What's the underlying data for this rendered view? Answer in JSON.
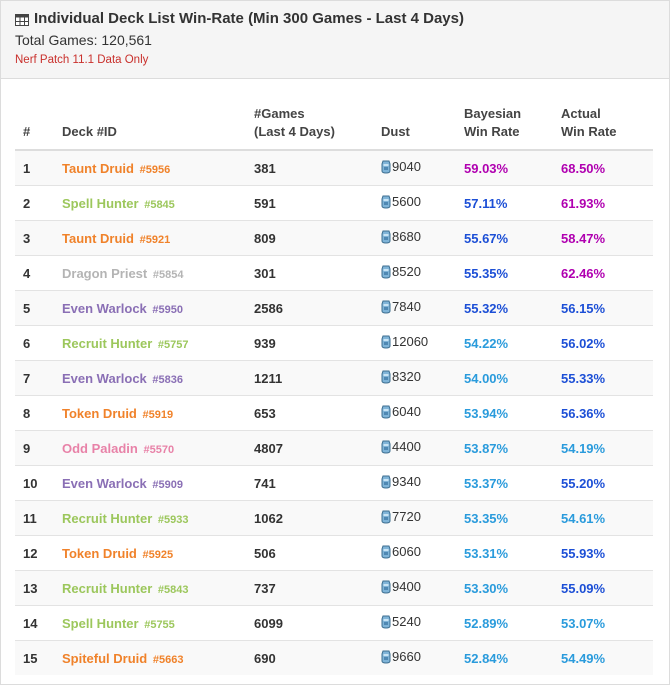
{
  "header": {
    "title": "Individual Deck List Win-Rate (Min 300 Games - Last 4 Days)",
    "total_games": "Total Games: 120,561",
    "patch_note": "Nerf Patch 11.1 Data Only"
  },
  "columns": {
    "rank": "#",
    "deck": "Deck #ID",
    "games_line1": "#Games",
    "games_line2": "(Last 4 Days)",
    "dust": "Dust",
    "bayes_line1": "Bayesian",
    "bayes_line2": "Win Rate",
    "actual_line1": "Actual",
    "actual_line2": "Win Rate"
  },
  "colors": {
    "Druid": "#f0822a",
    "Hunter": "#9cc75c",
    "Priest": "#b4b4b4",
    "Warlock": "#8a6fb5",
    "Paladin": "#e882a8",
    "rate_purple": "#b000b0",
    "rate_blue": "#1c4fd6",
    "rate_light": "#2a9bdc"
  },
  "rows": [
    {
      "rank": "1",
      "deck": "Taunt Druid",
      "id": "#5956",
      "cls": "Druid",
      "games": "381",
      "dust": "9040",
      "bayes": "59.03%",
      "actual": "68.50%",
      "bayes_color": "rate_purple",
      "actual_color": "rate_purple"
    },
    {
      "rank": "2",
      "deck": "Spell Hunter",
      "id": "#5845",
      "cls": "Hunter",
      "games": "591",
      "dust": "5600",
      "bayes": "57.11%",
      "actual": "61.93%",
      "bayes_color": "rate_blue",
      "actual_color": "rate_purple"
    },
    {
      "rank": "3",
      "deck": "Taunt Druid",
      "id": "#5921",
      "cls": "Druid",
      "games": "809",
      "dust": "8680",
      "bayes": "55.67%",
      "actual": "58.47%",
      "bayes_color": "rate_blue",
      "actual_color": "rate_purple"
    },
    {
      "rank": "4",
      "deck": "Dragon Priest",
      "id": "#5854",
      "cls": "Priest",
      "games": "301",
      "dust": "8520",
      "bayes": "55.35%",
      "actual": "62.46%",
      "bayes_color": "rate_blue",
      "actual_color": "rate_purple"
    },
    {
      "rank": "5",
      "deck": "Even Warlock",
      "id": "#5950",
      "cls": "Warlock",
      "games": "2586",
      "dust": "7840",
      "bayes": "55.32%",
      "actual": "56.15%",
      "bayes_color": "rate_blue",
      "actual_color": "rate_blue"
    },
    {
      "rank": "6",
      "deck": "Recruit Hunter",
      "id": "#5757",
      "cls": "Hunter",
      "games": "939",
      "dust": "12060",
      "bayes": "54.22%",
      "actual": "56.02%",
      "bayes_color": "rate_light",
      "actual_color": "rate_blue"
    },
    {
      "rank": "7",
      "deck": "Even Warlock",
      "id": "#5836",
      "cls": "Warlock",
      "games": "1211",
      "dust": "8320",
      "bayes": "54.00%",
      "actual": "55.33%",
      "bayes_color": "rate_light",
      "actual_color": "rate_blue"
    },
    {
      "rank": "8",
      "deck": "Token Druid",
      "id": "#5919",
      "cls": "Druid",
      "games": "653",
      "dust": "6040",
      "bayes": "53.94%",
      "actual": "56.36%",
      "bayes_color": "rate_light",
      "actual_color": "rate_blue"
    },
    {
      "rank": "9",
      "deck": "Odd Paladin",
      "id": "#5570",
      "cls": "Paladin",
      "games": "4807",
      "dust": "4400",
      "bayes": "53.87%",
      "actual": "54.19%",
      "bayes_color": "rate_light",
      "actual_color": "rate_light"
    },
    {
      "rank": "10",
      "deck": "Even Warlock",
      "id": "#5909",
      "cls": "Warlock",
      "games": "741",
      "dust": "9340",
      "bayes": "53.37%",
      "actual": "55.20%",
      "bayes_color": "rate_light",
      "actual_color": "rate_blue"
    },
    {
      "rank": "11",
      "deck": "Recruit Hunter",
      "id": "#5933",
      "cls": "Hunter",
      "games": "1062",
      "dust": "7720",
      "bayes": "53.35%",
      "actual": "54.61%",
      "bayes_color": "rate_light",
      "actual_color": "rate_light"
    },
    {
      "rank": "12",
      "deck": "Token Druid",
      "id": "#5925",
      "cls": "Druid",
      "games": "506",
      "dust": "6060",
      "bayes": "53.31%",
      "actual": "55.93%",
      "bayes_color": "rate_light",
      "actual_color": "rate_blue"
    },
    {
      "rank": "13",
      "deck": "Recruit Hunter",
      "id": "#5843",
      "cls": "Hunter",
      "games": "737",
      "dust": "9400",
      "bayes": "53.30%",
      "actual": "55.09%",
      "bayes_color": "rate_light",
      "actual_color": "rate_blue"
    },
    {
      "rank": "14",
      "deck": "Spell Hunter",
      "id": "#5755",
      "cls": "Hunter",
      "games": "6099",
      "dust": "5240",
      "bayes": "52.89%",
      "actual": "53.07%",
      "bayes_color": "rate_light",
      "actual_color": "rate_light"
    },
    {
      "rank": "15",
      "deck": "Spiteful Druid",
      "id": "#5663",
      "cls": "Druid",
      "games": "690",
      "dust": "9660",
      "bayes": "52.84%",
      "actual": "54.49%",
      "bayes_color": "rate_light",
      "actual_color": "rate_light"
    }
  ]
}
